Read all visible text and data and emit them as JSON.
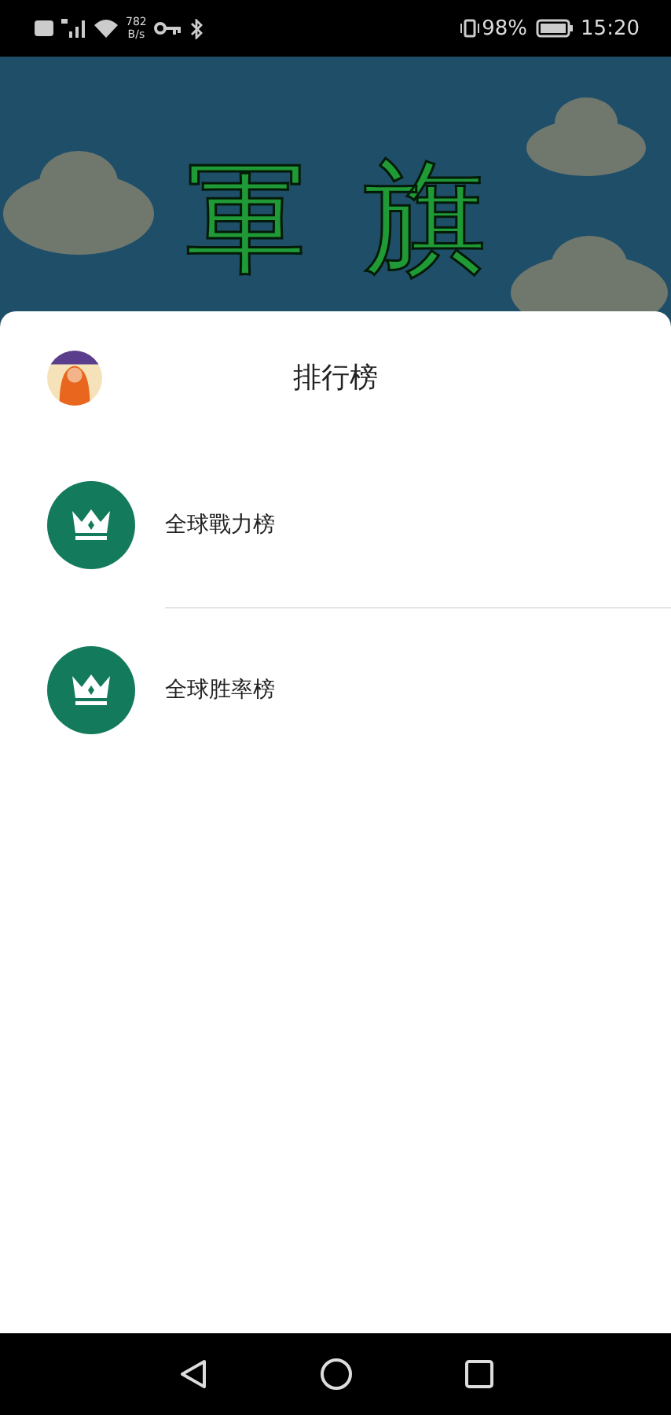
{
  "status_bar": {
    "speed_value": "782",
    "speed_unit": "B/s",
    "battery": "98%",
    "time": "15:20"
  },
  "banner": {
    "title": "軍旗"
  },
  "sheet": {
    "title": "排行榜",
    "items": [
      {
        "label": "全球戰力榜"
      },
      {
        "label": "全球胜率榜"
      }
    ]
  }
}
